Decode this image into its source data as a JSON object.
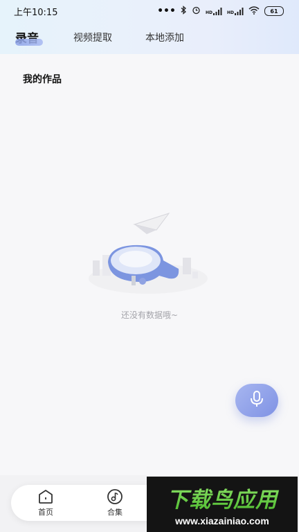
{
  "status_bar": {
    "time": "上午10:15",
    "dots": "•••",
    "signal1": "HD",
    "signal2": "HD",
    "battery": "61"
  },
  "tabs": [
    {
      "label": "录音",
      "active": true
    },
    {
      "label": "视频提取",
      "active": false
    },
    {
      "label": "本地添加",
      "active": false
    }
  ],
  "section_title": "我的作品",
  "empty_state": {
    "text": "还没有数据哦~"
  },
  "bottom_nav": [
    {
      "label": "首页",
      "icon": "home-icon"
    },
    {
      "label": "合集",
      "icon": "music-note-icon"
    }
  ],
  "watermark": {
    "title": "下载鸟应用",
    "url": "www.xiazainiao.com"
  },
  "colors": {
    "accent": "#8296e6",
    "watermark_green": "#5cc43a"
  }
}
